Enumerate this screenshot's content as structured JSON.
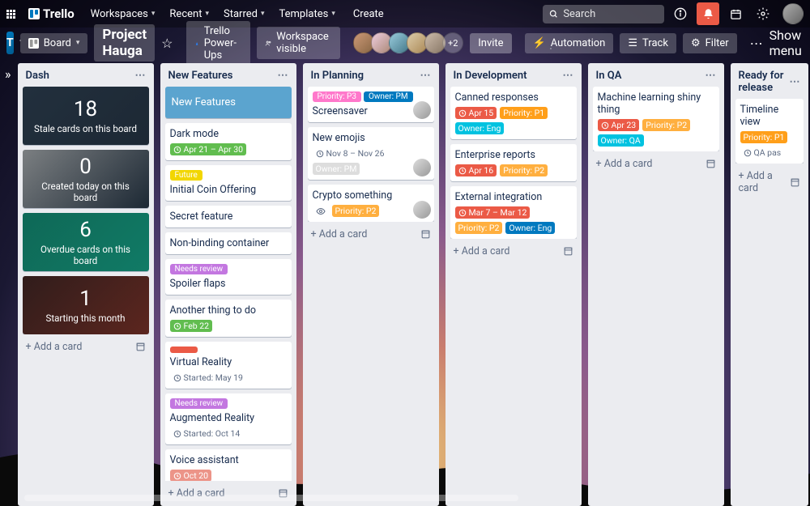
{
  "brand": "Trello",
  "top_menu": [
    "Workspaces",
    "Recent",
    "Starred",
    "Templates"
  ],
  "create": "Create",
  "search_placeholder": "Search",
  "ws_initial": "T",
  "board_btn": "Board",
  "board_name": "Project Hauga",
  "powerups": "Trello Power-Ups",
  "visibility": "Workspace visible",
  "extra_members": "+2",
  "invite": "Invite",
  "automation": "Automation",
  "track": "Track",
  "filter": "Filter",
  "show_menu": "Show menu",
  "add_card": "Add a card",
  "colors": {
    "green": "#61bd4f",
    "yellow": "#f2d600",
    "orange": "#ff9f1a",
    "red": "#eb5a46",
    "purple": "#c377e0",
    "pink": "#ff78cb",
    "sky": "#00c2e0",
    "blue": "#0079bf",
    "lightgreen": "#7bc86c",
    "paleorange": "#ffaf3f",
    "darksalmon": "#ec9488"
  },
  "lists": [
    {
      "name": "Dash",
      "type": "dash",
      "cards": [
        {
          "big": "18",
          "small": "Stale cards on this board",
          "cover": "dash-cover1"
        },
        {
          "big": "0",
          "small": "Created today on this board",
          "cover": "dash-cover2"
        },
        {
          "big": "6",
          "small": "Overdue cards on this board",
          "cover": "dash-cover3"
        },
        {
          "big": "1",
          "small": "Starting this month",
          "cover": "dash-cover4"
        }
      ]
    },
    {
      "name": "New Features",
      "cards": [
        {
          "title": "New Features",
          "style": "blue"
        },
        {
          "title": "Dark mode",
          "badges": [
            {
              "type": "due",
              "text": "Apr 21 – Apr 30",
              "color": "green"
            }
          ]
        },
        {
          "title": "Initial Coin Offering",
          "labels": [
            {
              "text": "Future",
              "color": "yellow"
            }
          ]
        },
        {
          "title": "Secret feature"
        },
        {
          "title": "Non-binding container"
        },
        {
          "title": "Spoiler flaps",
          "labels": [
            {
              "text": "Needs review",
              "color": "purple"
            }
          ]
        },
        {
          "title": "Another thing to do",
          "badges": [
            {
              "type": "due",
              "text": "Feb 22",
              "color": "green"
            }
          ]
        },
        {
          "title": "Virtual Reality",
          "labels": [
            {
              "text": "",
              "color": "red"
            }
          ],
          "badges": [
            {
              "type": "text",
              "text": "Started: May 19"
            }
          ]
        },
        {
          "title": "Augmented Reality",
          "labels": [
            {
              "text": "Needs review",
              "color": "purple"
            }
          ],
          "badges": [
            {
              "type": "text",
              "text": "Started: Oct 14"
            }
          ]
        },
        {
          "title": "Voice assistant",
          "badges": [
            {
              "type": "due",
              "text": "Oct 20",
              "color": "darksalmon"
            }
          ]
        }
      ]
    },
    {
      "name": "In Planning",
      "cards": [
        {
          "title": "Screensaver",
          "labels": [
            {
              "text": "Priority: P3",
              "color": "pink"
            },
            {
              "text": "Owner: PM",
              "color": "blue"
            }
          ],
          "avatar": true
        },
        {
          "title": "New emojis",
          "badges": [
            {
              "type": "text",
              "text": "Nov 8 – Nov 26"
            },
            {
              "type": "pill",
              "text": "Owner: PM"
            }
          ],
          "avatar": true
        },
        {
          "title": "Crypto something",
          "badges": [
            {
              "type": "eye"
            },
            {
              "type": "pill",
              "text": "Priority: P2",
              "color": "paleorange"
            }
          ],
          "avatar": true
        }
      ]
    },
    {
      "name": "In Development",
      "cards": [
        {
          "title": "Canned responses",
          "badges": [
            {
              "type": "due",
              "text": "Apr 15",
              "color": "red"
            },
            {
              "type": "pill",
              "text": "Priority: P1",
              "color": "orange"
            },
            {
              "type": "pill",
              "text": "Owner: Eng",
              "color": "sky"
            }
          ]
        },
        {
          "title": "Enterprise reports",
          "badges": [
            {
              "type": "due",
              "text": "Apr 16",
              "color": "red"
            },
            {
              "type": "pill",
              "text": "Priority: P2",
              "color": "paleorange"
            }
          ]
        },
        {
          "title": "External integration",
          "badges": [
            {
              "type": "due",
              "text": "Mar 7 – Mar 12",
              "color": "red"
            },
            {
              "type": "pill",
              "text": "Priority: P2",
              "color": "paleorange"
            },
            {
              "type": "pill",
              "text": "Owner: Eng",
              "color": "blue"
            }
          ]
        }
      ]
    },
    {
      "name": "In QA",
      "cards": [
        {
          "title": "Machine learning shiny thing",
          "badges": [
            {
              "type": "due",
              "text": "Apr 23",
              "color": "red"
            },
            {
              "type": "pill",
              "text": "Priority: P2",
              "color": "paleorange"
            },
            {
              "type": "pill",
              "text": "Owner: QA",
              "color": "sky"
            }
          ]
        }
      ]
    },
    {
      "name": "Ready for release",
      "clipped": true,
      "cards": [
        {
          "title": "Timeline view",
          "badges": [
            {
              "type": "pill",
              "text": "Priority: P1",
              "color": "orange"
            },
            {
              "type": "text",
              "text": "QA pas"
            }
          ]
        }
      ]
    }
  ]
}
